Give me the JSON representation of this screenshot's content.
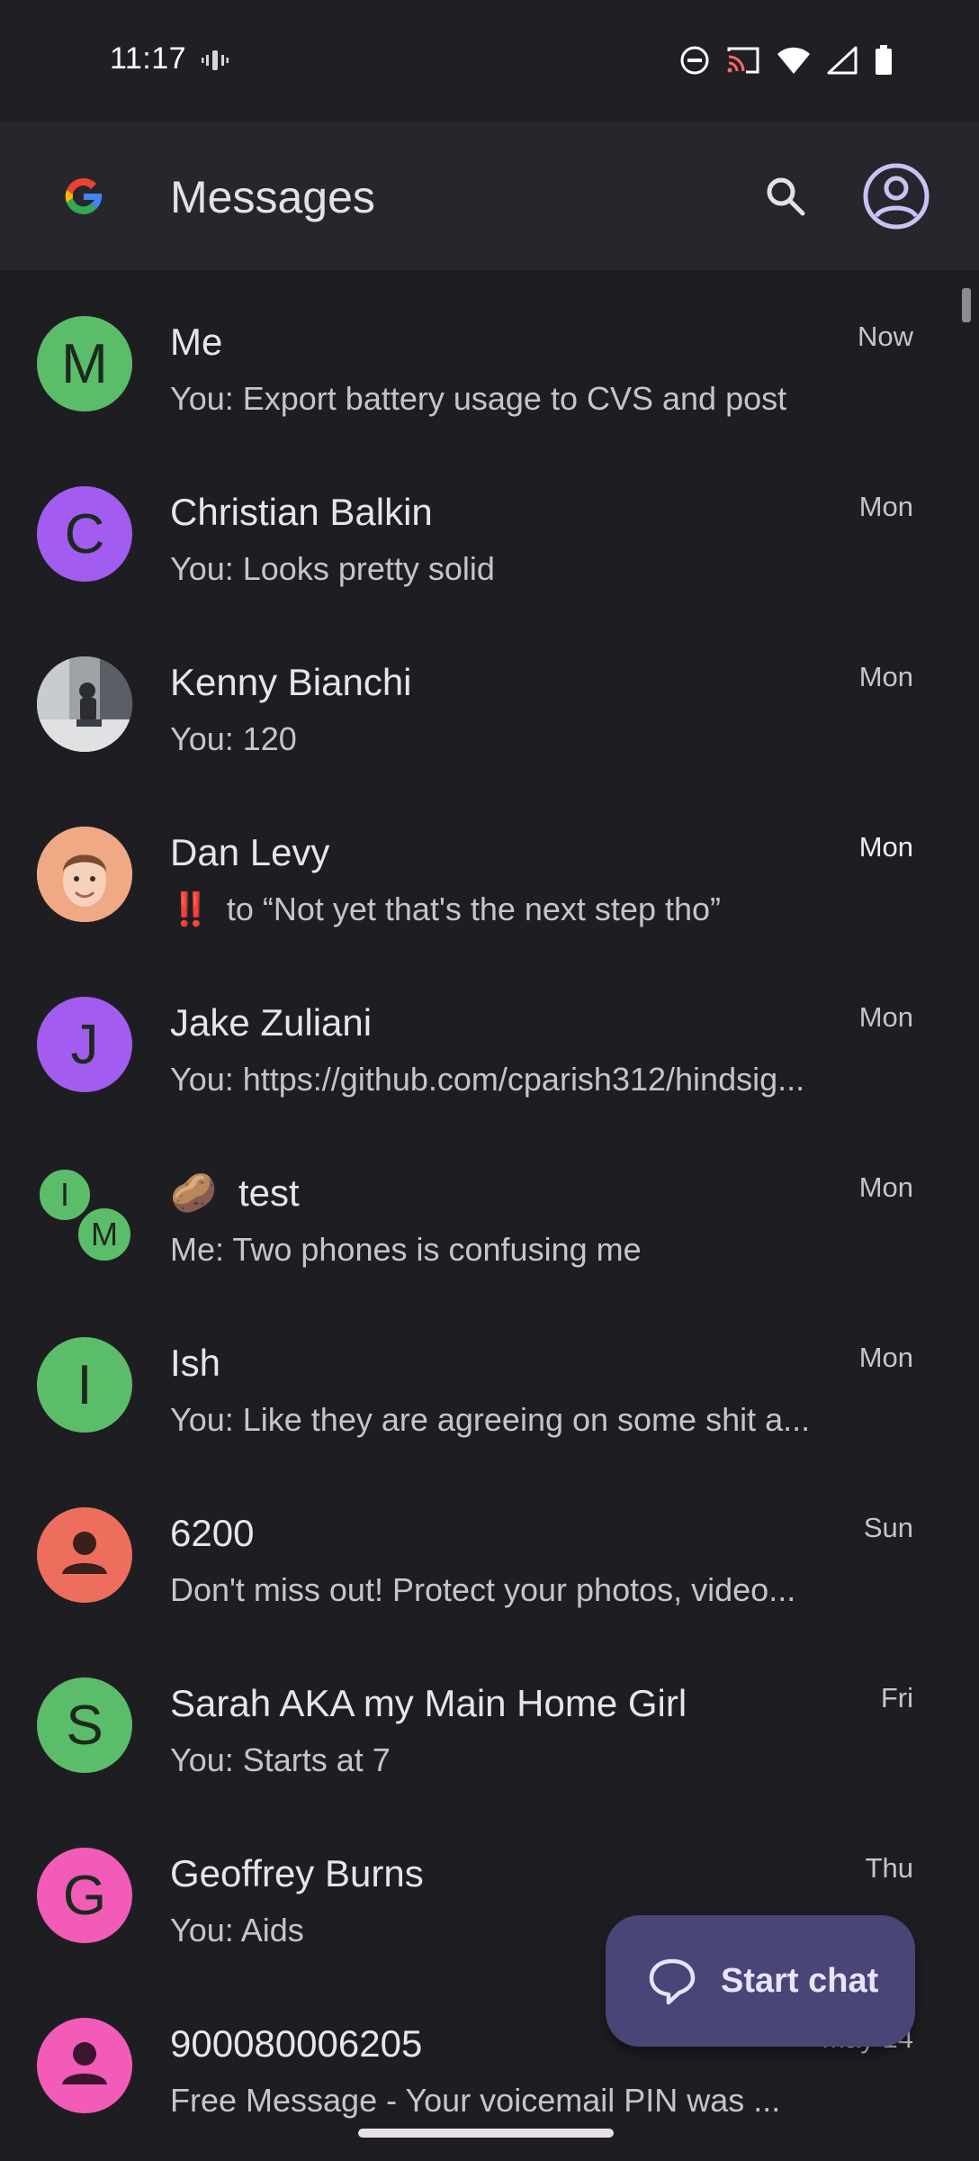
{
  "status_bar": {
    "time": "11:17"
  },
  "app_bar": {
    "title": "Messages"
  },
  "conversations": [
    {
      "name": "Me",
      "snippet": "You: Export battery usage to CVS and post",
      "time": "Now",
      "avatar_letter": "M",
      "avatar_color": "#5bbd6a",
      "avatar_type": "letter"
    },
    {
      "name": "Christian Balkin",
      "snippet": "You: Looks pretty solid",
      "time": "Mon",
      "avatar_letter": "C",
      "avatar_color": "#a35cf0",
      "avatar_type": "letter"
    },
    {
      "name": "Kenny Bianchi",
      "snippet": "You: 120",
      "time": "Mon",
      "avatar_type": "photo"
    },
    {
      "name": "Dan Levy",
      "snippet": "to “Not yet that's the next step tho”",
      "snippet_icon": "‼️",
      "time": "Mon",
      "avatar_type": "memoji",
      "avatar_color": "#f0a985"
    },
    {
      "name": "Jake Zuliani",
      "snippet": "You: https://github.com/cparish312/hindsig...",
      "time": "Mon",
      "avatar_letter": "J",
      "avatar_color": "#a35cf0",
      "avatar_type": "letter"
    },
    {
      "name": "test",
      "name_emoji": "🥔",
      "snippet": "Me: Two phones is confusing me",
      "time": "Mon",
      "avatar_type": "group",
      "group_letters": [
        "I",
        "M"
      ],
      "avatar_color": "#5bbd6a"
    },
    {
      "name": "Ish",
      "snippet": "You: Like they are agreeing on some shit a...",
      "time": "Mon",
      "avatar_letter": "I",
      "avatar_color": "#5bbd6a",
      "avatar_type": "letter"
    },
    {
      "name": "6200",
      "snippet": "Don't miss out! Protect your photos, video...",
      "time": "Sun",
      "avatar_color": "#ee6e5e",
      "avatar_type": "person"
    },
    {
      "name": "Sarah AKA my Main Home Girl",
      "snippet": "You: Starts at 7",
      "time": "Fri",
      "avatar_letter": "S",
      "avatar_color": "#5bbd6a",
      "avatar_type": "letter"
    },
    {
      "name": "Geoffrey Burns",
      "snippet": "You: Aids",
      "time": "Thu",
      "avatar_letter": "G",
      "avatar_color": "#f35bb9",
      "avatar_type": "letter"
    },
    {
      "name": "900080006205",
      "snippet": "Free Message - Your voicemail PIN was ...",
      "time": "May 14",
      "avatar_color": "#f35bb9",
      "avatar_type": "person"
    }
  ],
  "fab": {
    "label": "Start chat"
  },
  "colors": {
    "background": "#1e1e22",
    "app_bar": "#26262c",
    "fab": "#4a4577",
    "account_icon": "#c9c2f5"
  },
  "icons": {
    "status": [
      "vibrate-icon",
      "dnd-icon",
      "cast-icon",
      "wifi-icon",
      "signal-icon",
      "battery-icon"
    ],
    "app_bar": [
      "google-logo",
      "search-icon",
      "account-icon"
    ],
    "fab": "chat-bubble-icon"
  }
}
